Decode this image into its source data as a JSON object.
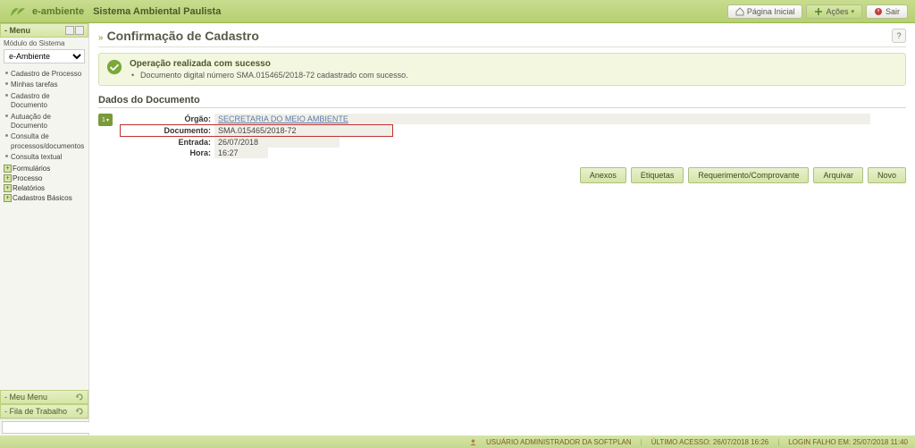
{
  "header": {
    "logo_text": "e-ambiente",
    "system_title": "Sistema Ambiental Paulista",
    "btn_home": "Página Inicial",
    "btn_actions": "Ações",
    "btn_exit": "Sair"
  },
  "sidebar": {
    "menu_label": "- Menu",
    "module_label": "Módulo do Sistema",
    "module_selected": "e-Ambiente",
    "items": [
      "Cadastro de Processo",
      "Minhas tarefas",
      "Cadastro de Documento",
      "Autuação de Documento",
      "Consulta de processos/documentos",
      "Consulta textual"
    ],
    "groups": [
      "Formulários",
      "Processo",
      "Relatórios",
      "Cadastros Básicos"
    ],
    "meu_menu": "- Meu Menu",
    "fila": "- Fila de Trabalho"
  },
  "page": {
    "title": "Confirmação de Cadastro",
    "help": "?"
  },
  "success": {
    "title": "Operação realizada com sucesso",
    "message": "Documento digital número SMA.015465/2018-72 cadastrado com sucesso."
  },
  "section": {
    "title": "Dados do Documento"
  },
  "doc_toggle": "1",
  "details": {
    "orgao_label": "Órgão:",
    "orgao_value": "SECRETARIA DO MEIO AMBIENTE",
    "documento_label": "Documento:",
    "documento_value": "SMA.015465/2018-72",
    "entrada_label": "Entrada:",
    "entrada_value": "26/07/2018",
    "hora_label": "Hora:",
    "hora_value": "16:27"
  },
  "actions": {
    "anexos": "Anexos",
    "etiquetas": "Etiquetas",
    "requerimento": "Requerimento/Comprovante",
    "arquivar": "Arquivar",
    "novo": "Novo"
  },
  "footer": {
    "user": "USUÁRIO ADMINISTRADOR DA SOFTPLAN",
    "ultimo": "ÚLTIMO ACESSO: 26/07/2018 16:26",
    "falho": "LOGIN FALHO EM: 25/07/2018 11:40"
  }
}
